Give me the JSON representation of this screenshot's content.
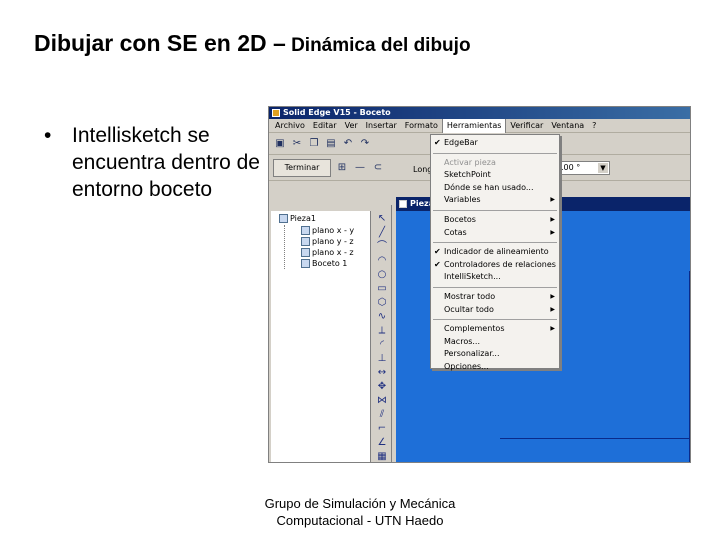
{
  "slide": {
    "title_main": "Dibujar con SE en 2D –",
    "title_sub": " Dinámica del dibujo",
    "bullet_marker": "•",
    "bullet_text": "Intellisketch se encuentra dentro de entorno boceto",
    "footer_line1": "Grupo de Simulación y Mecánica",
    "footer_line2": "Computacional - UTN Haedo"
  },
  "app": {
    "window_title": "Solid Edge V15 - Boceto",
    "menu": [
      "Archivo",
      "Editar",
      "Ver",
      "Insertar",
      "Formato",
      "Herramientas",
      "Verificar",
      "Ventana",
      "?"
    ],
    "active_menu": "Herramientas",
    "finish_button": "Terminar",
    "long_label": "Long",
    "angle_value": ".00 °",
    "document_title": "Pieza1",
    "tree": {
      "root": "Pieza1",
      "items": [
        "plano x - y",
        "plano y - z",
        "plano x - z",
        "Boceto 1"
      ]
    },
    "dropdown": {
      "items": [
        {
          "label": "EdgeBar",
          "checked": true,
          "disabled": false,
          "submenu": false
        },
        {
          "label": "Activar pieza",
          "checked": false,
          "disabled": true,
          "submenu": false
        },
        {
          "label": "SketchPoint",
          "checked": false,
          "disabled": false,
          "submenu": false
        },
        {
          "label": "Dónde se han usado...",
          "checked": false,
          "disabled": false,
          "submenu": false
        },
        {
          "label": "Variables",
          "checked": false,
          "disabled": false,
          "submenu": true
        },
        {
          "label": "Bocetos",
          "checked": false,
          "disabled": false,
          "submenu": true
        },
        {
          "label": "Cotas",
          "checked": false,
          "disabled": false,
          "submenu": true
        },
        {
          "label": "Indicador de alineamiento",
          "checked": true,
          "disabled": false,
          "submenu": false
        },
        {
          "label": "Controladores de relaciones",
          "checked": true,
          "disabled": false,
          "submenu": false
        },
        {
          "label": "IntelliSketch...",
          "checked": false,
          "disabled": false,
          "submenu": false
        },
        {
          "label": "Mostrar todo",
          "checked": false,
          "disabled": false,
          "submenu": true
        },
        {
          "label": "Ocultar todo",
          "checked": false,
          "disabled": false,
          "submenu": true
        },
        {
          "label": "Complementos",
          "checked": false,
          "disabled": false,
          "submenu": true
        },
        {
          "label": "Macros...",
          "checked": false,
          "disabled": false,
          "submenu": false
        },
        {
          "label": "Personalizar...",
          "checked": false,
          "disabled": false,
          "submenu": false
        },
        {
          "label": "Opciones...",
          "checked": false,
          "disabled": false,
          "submenu": false
        }
      ]
    },
    "toolbar_icons": [
      "save-icon",
      "cut-icon",
      "copy-icon",
      "paste-icon",
      "undo-icon",
      "redo-icon"
    ],
    "sidebar_icons": [
      "select-icon",
      "line-icon",
      "arc-icon",
      "tangent-arc-icon",
      "circle-icon",
      "rectangle-icon",
      "polygon-icon",
      "curve-icon",
      "trim-icon",
      "fillet-icon",
      "relation-icon",
      "dimension-icon",
      "move-icon",
      "mirror-icon",
      "offset-icon",
      "connect-icon",
      "angle-icon",
      "grid-icon"
    ],
    "colors": {
      "canvas": "#1e6fd8",
      "titlebar": "#0a246a",
      "chrome": "#d4d0c8"
    }
  }
}
